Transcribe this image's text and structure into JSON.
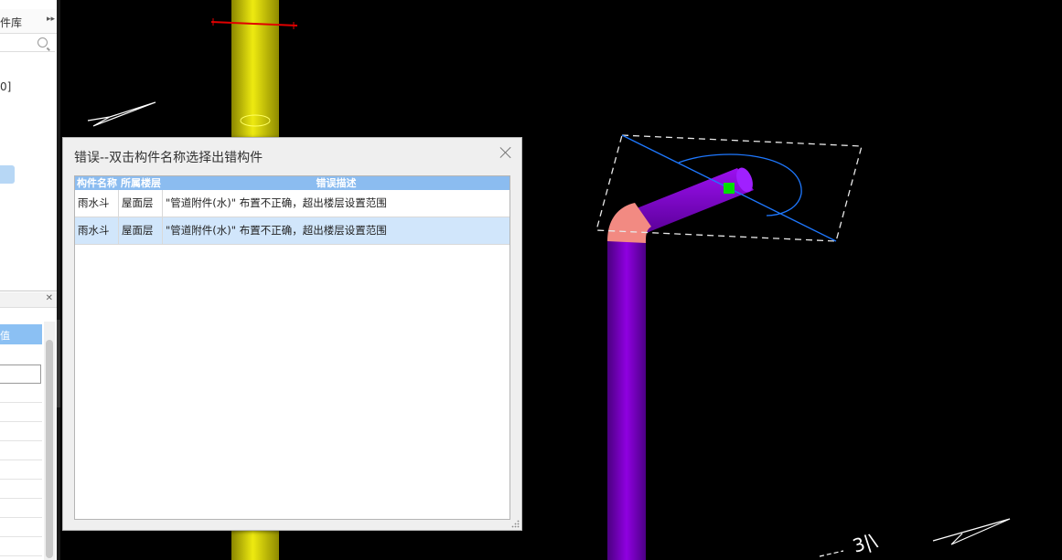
{
  "left_panel": {
    "tab_label": "件库",
    "expand_glyph": "▸▸",
    "item_label": "0]",
    "close_glyph": "✕",
    "bar_label": "值"
  },
  "dialog": {
    "title": "错误--双击构件名称选择出错构件",
    "columns": [
      "构件名称",
      "所属楼层",
      "错误描述"
    ],
    "rows": [
      {
        "name": "雨水斗",
        "floor": "屋面层",
        "desc": "\"管道附件(水)\" 布置不正确，超出楼层设置范围"
      },
      {
        "name": "雨水斗",
        "floor": "屋面层",
        "desc": "\"管道附件(水)\" 布置不正确，超出楼层设置范围"
      }
    ]
  },
  "scene": {
    "background": "#000000",
    "pipe_yellow": "#d9d400",
    "pipe_purple": "#7d00c8",
    "elbow_color": "#f08080",
    "marker_color": "#00e000",
    "outline_blue": "#1e78ff",
    "compass_label": "3|\\"
  }
}
